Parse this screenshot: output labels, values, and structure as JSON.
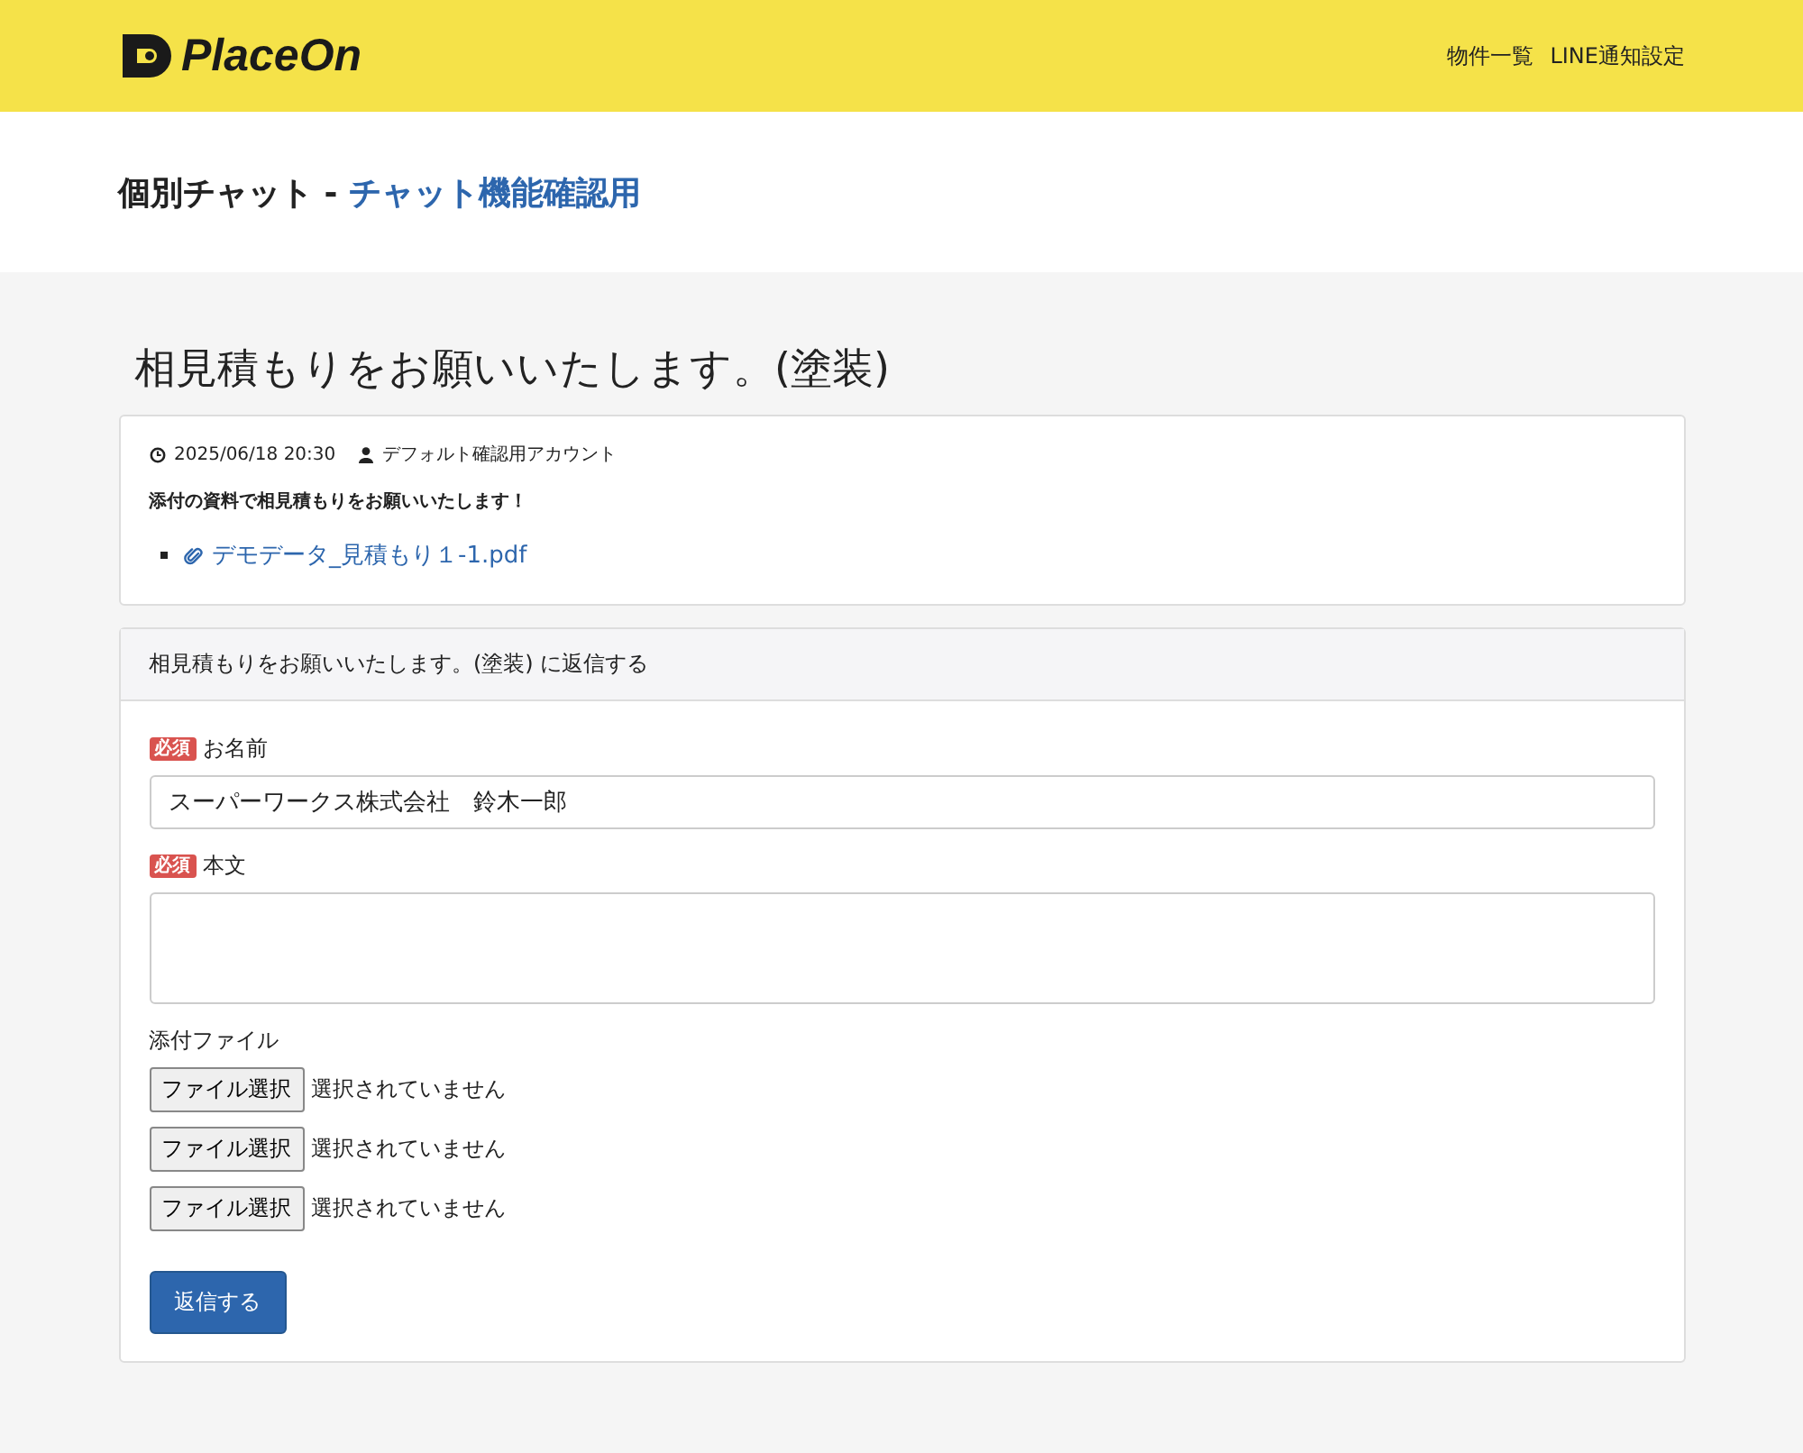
{
  "header": {
    "logo": "PlaceOn",
    "nav": [
      "物件一覧",
      "LINE通知設定"
    ]
  },
  "page_title": {
    "prefix": "個別チャット - ",
    "link": "チャット機能確認用"
  },
  "message": {
    "title": "相見積もりをお願いいたします。(塗装)",
    "datetime": "2025/06/18 20:30",
    "author": "デフォルト確認用アカウント",
    "body": "添付の資料で相見積もりをお願いいたします！",
    "attachments": [
      "デモデータ_見積もり１-1.pdf"
    ]
  },
  "reply": {
    "heading": "相見積もりをお願いいたします。(塗装) に返信する",
    "fields": [
      {
        "kind": "text",
        "required": true,
        "badge": "必須",
        "label": "お名前",
        "value": "スーパーワークス株式会社　鈴木一郎"
      },
      {
        "kind": "textarea",
        "required": true,
        "badge": "必須",
        "label": "本文"
      }
    ],
    "attachments_label": "添付ファイル",
    "files": [
      {
        "button": "ファイル選択",
        "status": "選択されていません"
      },
      {
        "button": "ファイル選択",
        "status": "選択されていません"
      },
      {
        "button": "ファイル選択",
        "status": "選択されていません"
      }
    ],
    "submit": "返信する"
  }
}
